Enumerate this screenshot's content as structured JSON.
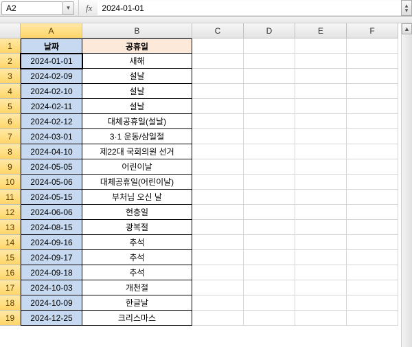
{
  "nameBox": "A2",
  "formulaValue": "2024-01-01",
  "fxLabel": "fx",
  "columns": [
    "A",
    "B",
    "C",
    "D",
    "E",
    "F"
  ],
  "selectedColumn": "A",
  "activeCell": {
    "col": "A",
    "row": 2
  },
  "tableHeader": {
    "date": "날짜",
    "holiday": "공휴일"
  },
  "rows": [
    {
      "date": "2024-01-01",
      "holiday": "새해"
    },
    {
      "date": "2024-02-09",
      "holiday": "설날"
    },
    {
      "date": "2024-02-10",
      "holiday": "설날"
    },
    {
      "date": "2024-02-11",
      "holiday": "설날"
    },
    {
      "date": "2024-02-12",
      "holiday": "대체공휴일(설날)"
    },
    {
      "date": "2024-03-01",
      "holiday": "3·1 운동/삼일절"
    },
    {
      "date": "2024-04-10",
      "holiday": "제22대 국회의원 선거"
    },
    {
      "date": "2024-05-05",
      "holiday": "어린이날"
    },
    {
      "date": "2024-05-06",
      "holiday": "대체공휴일(어린이날)"
    },
    {
      "date": "2024-05-15",
      "holiday": "부처님 오신 날"
    },
    {
      "date": "2024-06-06",
      "holiday": "현충일"
    },
    {
      "date": "2024-08-15",
      "holiday": "광복절"
    },
    {
      "date": "2024-09-16",
      "holiday": "추석"
    },
    {
      "date": "2024-09-17",
      "holiday": "추석"
    },
    {
      "date": "2024-09-18",
      "holiday": "추석"
    },
    {
      "date": "2024-10-03",
      "holiday": "개천절"
    },
    {
      "date": "2024-10-09",
      "holiday": "한글날"
    },
    {
      "date": "2024-12-25",
      "holiday": "크리스마스"
    }
  ],
  "totalRows": 19
}
